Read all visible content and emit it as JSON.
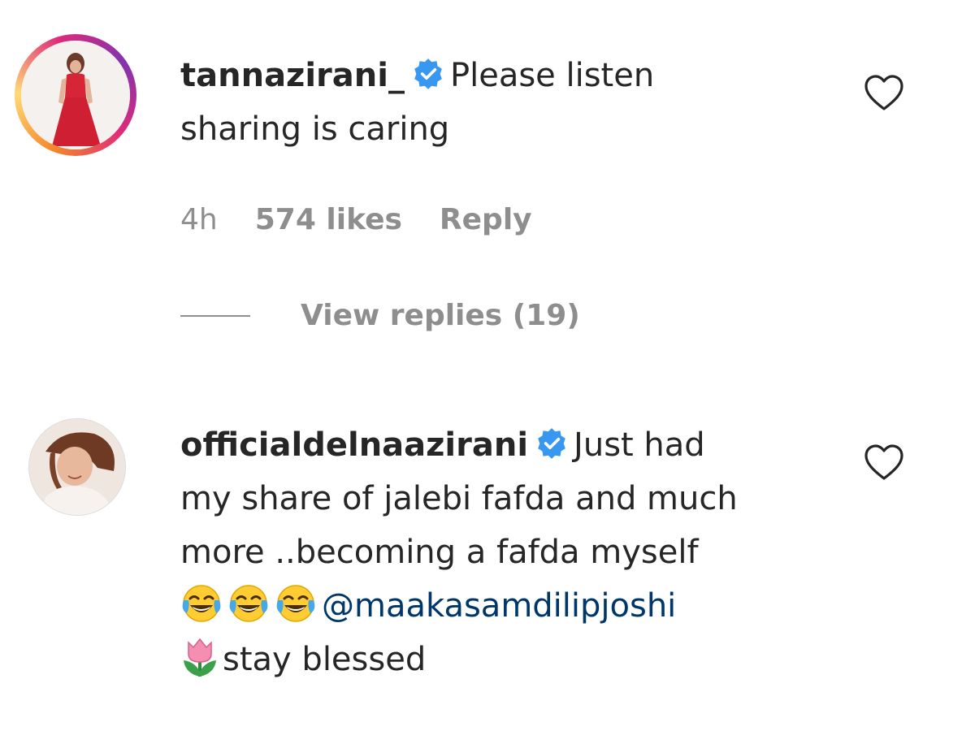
{
  "comments": [
    {
      "username": "tannazirani_",
      "verified": true,
      "text_line1": "Please listen",
      "text_line2": "sharing is caring",
      "time": "4h",
      "likes": "574 likes",
      "reply_label": "Reply",
      "view_replies": "View replies (19)"
    },
    {
      "username": "officialdelnaazirani",
      "verified": true,
      "text_line1": "Just had",
      "text_line2": "my share of jalebi fafda and much",
      "text_line3": "more ..becoming a fafda myself",
      "mention": "@maakasamdilipjoshi",
      "text_line5": "stay blessed",
      "emojis": [
        "face-with-tears-of-joy",
        "face-with-tears-of-joy",
        "face-with-tears-of-joy"
      ],
      "trailing_emoji": "tulip"
    }
  ],
  "colors": {
    "text": "#262626",
    "secondary": "#8e8e8e",
    "mention": "#00376b",
    "verified": "#3897f0"
  }
}
